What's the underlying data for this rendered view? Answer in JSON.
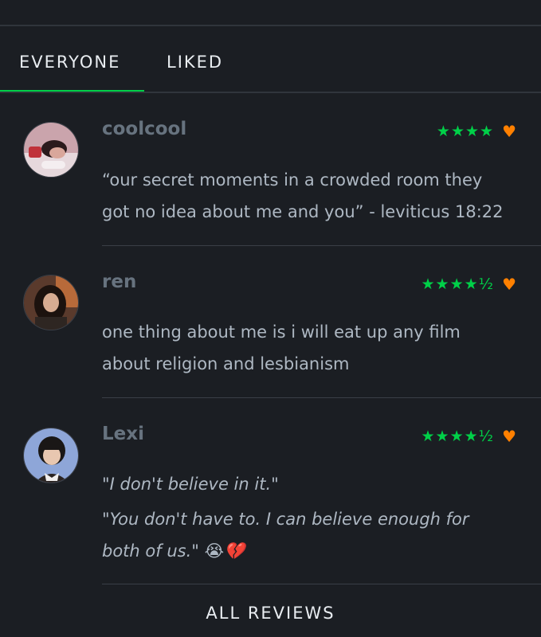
{
  "tabs": {
    "everyone": "EVERYONE",
    "liked": "LIKED"
  },
  "colors": {
    "background": "#1b1e23",
    "accent_green": "#00d048",
    "liked_orange": "#ff8000"
  },
  "reviews": [
    {
      "username": "coolcool",
      "stars": "★★★★",
      "rating_value": 4,
      "liked": true,
      "heart": "♥",
      "lines": [
        "“our secret moments in a crowded room they",
        "got no idea about me and you” - leviticus 18:22"
      ],
      "italic": false
    },
    {
      "username": "ren",
      "stars": "★★★★½",
      "rating_value": 4.5,
      "liked": true,
      "heart": "♥",
      "lines": [
        "one thing about me is i will eat up any film",
        "about religion and lesbianism"
      ],
      "italic": false
    },
    {
      "username": "Lexi",
      "stars": "★★★★½",
      "rating_value": 4.5,
      "liked": true,
      "heart": "♥",
      "lines": [
        "\"I don't believe in it.\"",
        "\"You don't have to. I can believe enough for",
        "both of us.\" 😭💔"
      ],
      "italic": true
    }
  ],
  "footer": {
    "all_reviews": "ALL REVIEWS"
  }
}
